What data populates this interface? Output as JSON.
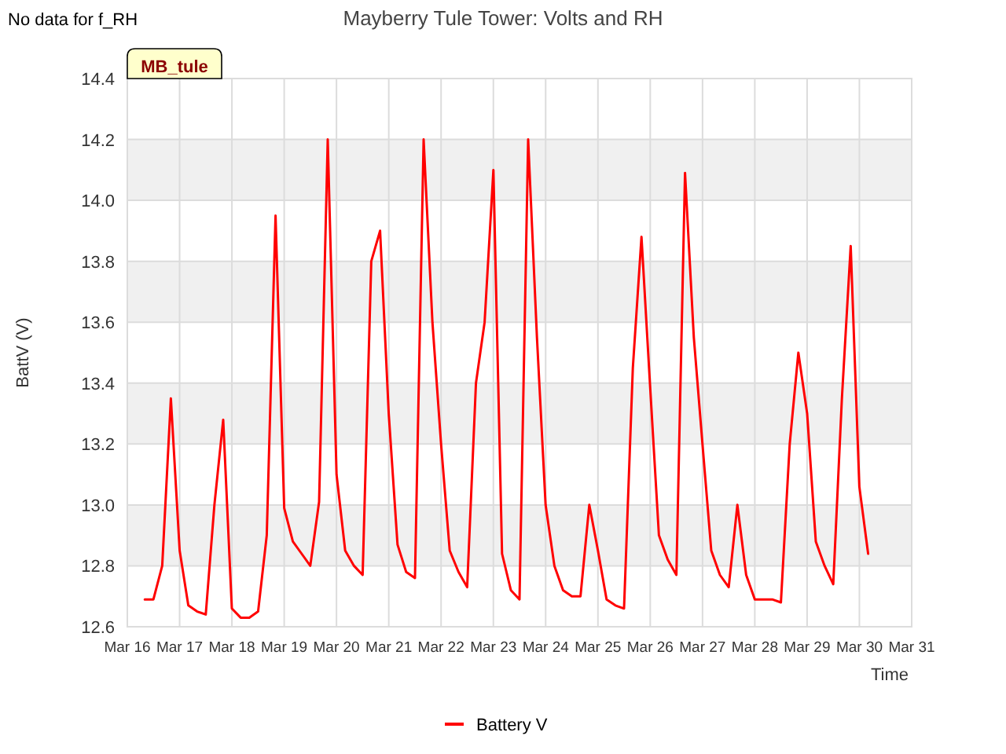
{
  "notice": "No data for f_RH",
  "station_tag": "MB_tule",
  "chart_data": {
    "type": "line",
    "title": "Mayberry Tule Tower: Volts and RH",
    "xlabel": "Time",
    "ylabel": "BattV (V)",
    "ylim": [
      12.6,
      14.4
    ],
    "grid": true,
    "yticks": [
      {
        "value": 12.6,
        "label": "12.6"
      },
      {
        "value": 12.8,
        "label": "12.8"
      },
      {
        "value": 13,
        "label": "13.0"
      },
      {
        "value": 13.2,
        "label": "13.2"
      },
      {
        "value": 13.4,
        "label": "13.4"
      },
      {
        "value": 13.6,
        "label": "13.6"
      },
      {
        "value": 13.8,
        "label": "13.8"
      },
      {
        "value": 14,
        "label": "14.0"
      },
      {
        "value": 14.2,
        "label": "14.2"
      },
      {
        "value": 14.4,
        "label": "14.4"
      }
    ],
    "categories": [
      "Mar 16",
      null,
      null,
      null,
      null,
      null,
      "Mar 17",
      null,
      null,
      null,
      null,
      null,
      "Mar 18",
      null,
      null,
      null,
      null,
      null,
      "Mar 19",
      null,
      null,
      null,
      null,
      null,
      "Mar 20",
      null,
      null,
      null,
      null,
      null,
      "Mar 21",
      null,
      null,
      null,
      null,
      null,
      "Mar 22",
      null,
      null,
      null,
      null,
      null,
      "Mar 23",
      null,
      null,
      null,
      null,
      null,
      "Mar 24",
      null,
      null,
      null,
      null,
      null,
      "Mar 25",
      null,
      null,
      null,
      null,
      null,
      "Mar 26",
      null,
      null,
      null,
      null,
      null,
      "Mar 27",
      null,
      null,
      null,
      null,
      null,
      "Mar 28",
      null,
      null,
      null,
      null,
      null,
      "Mar 29",
      null,
      null,
      null,
      null,
      null,
      "Mar 30",
      null,
      null,
      null,
      null,
      null,
      "Mar 31"
    ],
    "series": [
      {
        "name": "Battery V",
        "color": "#ff0000",
        "values": [
          null,
          null,
          12.69,
          12.69,
          12.8,
          13.35,
          12.85,
          12.67,
          12.65,
          12.64,
          13.0,
          13.28,
          12.66,
          12.63,
          12.63,
          12.65,
          12.9,
          13.95,
          12.99,
          12.88,
          12.84,
          12.8,
          13.01,
          14.2,
          13.1,
          12.85,
          12.8,
          12.77,
          13.8,
          13.9,
          13.3,
          12.87,
          12.78,
          12.76,
          14.2,
          13.6,
          13.2,
          12.85,
          12.78,
          12.73,
          13.4,
          13.6,
          14.1,
          12.84,
          12.72,
          12.69,
          14.2,
          13.55,
          13.0,
          12.8,
          12.72,
          12.7,
          12.7,
          13.0,
          12.85,
          12.69,
          12.67,
          12.66,
          13.45,
          13.88,
          13.38,
          12.9,
          12.82,
          12.77,
          14.09,
          13.55,
          13.2,
          12.85,
          12.77,
          12.73,
          13.0,
          12.77,
          12.69,
          12.69,
          12.69,
          12.68,
          13.2,
          13.5,
          13.3,
          12.88,
          12.8,
          12.74,
          13.35,
          13.85,
          13.06,
          12.84,
          null,
          null,
          null,
          null,
          null
        ]
      }
    ]
  }
}
